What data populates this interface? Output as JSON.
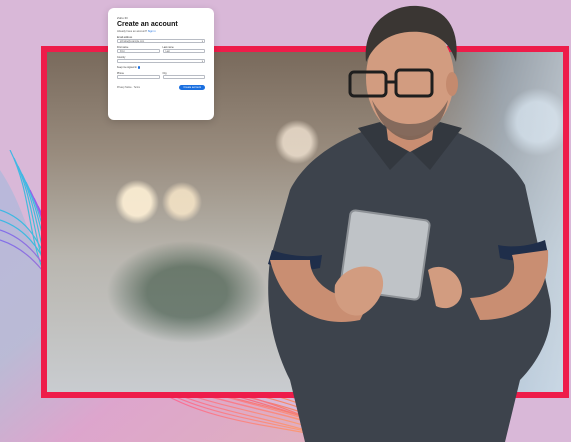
{
  "signup": {
    "brand": "Zoho ID",
    "title": "Create an account",
    "subtitle": "Already have an account?",
    "signin_link": "Sign in",
    "fields": {
      "email_label": "Email address",
      "email_value": "johndoe@example.com",
      "first_name_label": "First name",
      "first_name_placeholder": "First",
      "last_name_label": "Last name",
      "last_name_placeholder": "Last",
      "country_label": "Country",
      "country_value": "",
      "state_label": "State",
      "sign_in_label": "Keep me signed in",
      "phone_label": "Phone",
      "phone_placeholder": "",
      "company_label": "Org",
      "company_placeholder": ""
    },
    "footer_left": "Privacy Notice",
    "footer_left_2": "· Terms",
    "submit_label": "Create account"
  },
  "colors": {
    "frame": "#ee1c4a",
    "background": "#d9b8d8",
    "primary_button": "#1a6fe0"
  }
}
